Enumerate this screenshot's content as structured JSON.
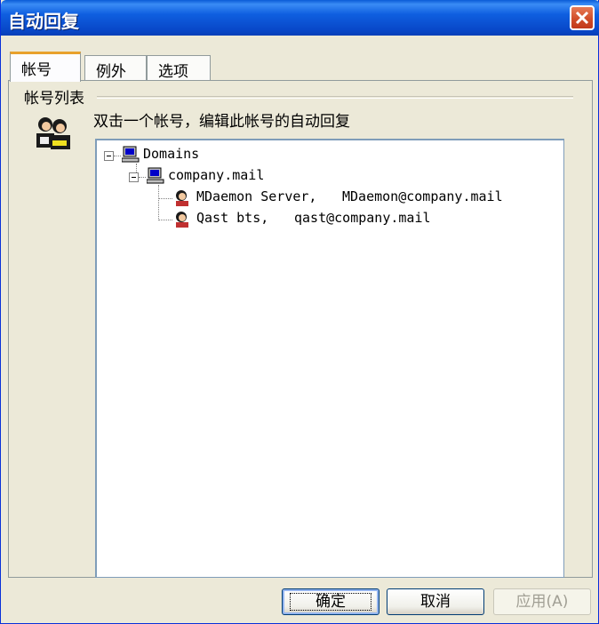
{
  "window": {
    "title": "自动回复"
  },
  "tabs": [
    {
      "label": "帐号",
      "active": true
    },
    {
      "label": "例外",
      "active": false
    },
    {
      "label": "选项",
      "active": false
    }
  ],
  "accounts_group": {
    "label": "帐号列表",
    "instruction": "双击一个帐号，编辑此帐号的自动回复"
  },
  "tree": {
    "root": "Domains",
    "domain": "company.mail",
    "accounts": [
      {
        "name": "MDaemon Server,",
        "email": "MDaemon@company.mail"
      },
      {
        "name": "Qast bts,",
        "email": "qast@company.mail"
      }
    ]
  },
  "buttons": {
    "ok": "确定",
    "cancel": "取消",
    "apply": "应用(A)"
  },
  "colors": {
    "titlebar": "#0a5bd6",
    "dialog_bg": "#ece9d8",
    "close_button": "#d4562e"
  }
}
